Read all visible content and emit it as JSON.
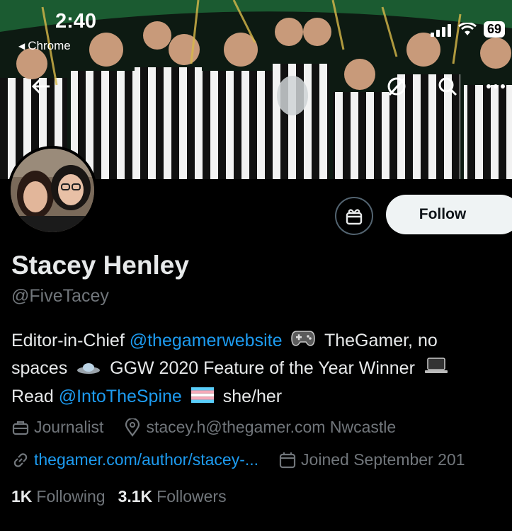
{
  "status_bar": {
    "time": "2:40",
    "back_app": "Chrome",
    "battery": "69"
  },
  "nav": {
    "back_icon": "arrow-left-icon",
    "grok_icon": "grok-icon",
    "search_icon": "search-icon",
    "more_icon": "more-icon"
  },
  "profile": {
    "display_name": "Stacey Henley",
    "handle": "@FiveTacey",
    "follow_label": "Follow",
    "bio": {
      "line1_prefix": "Editor-in-Chief ",
      "line1_mention": "@thegamerwebsite",
      "line1_suffix": " TheGamer, no",
      "line2_prefix": "spaces ",
      "line2_middle": " GGW 2020 Feature of the Year Winner",
      "line3_prefix": "Read ",
      "line3_mention": "@IntoTheSpine",
      "line3_suffix": " she/her"
    },
    "meta": {
      "profession": "Journalist",
      "location": "stacey.h@thegamer.com Nwcastle",
      "website": "thegamer.com/author/stacey-...",
      "joined": "Joined September 201"
    },
    "stats": {
      "following_count": "1K",
      "following_label": "Following",
      "followers_count": "3.1K",
      "followers_label": "Followers"
    }
  },
  "colors": {
    "accent": "#1d9bf0",
    "text_primary": "#e7e9ea",
    "text_secondary": "#71767b",
    "background": "#000000",
    "follow_bg": "#eff3f4"
  }
}
